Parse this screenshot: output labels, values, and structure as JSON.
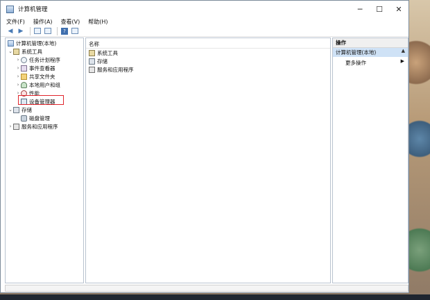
{
  "window": {
    "title": "计算机管理",
    "controls": {
      "minimize": "─",
      "maximize": "☐",
      "close": "✕"
    }
  },
  "menu": [
    "文件(F)",
    "操作(A)",
    "查看(V)",
    "帮助(H)"
  ],
  "toolbar": {
    "help": "?"
  },
  "tree": {
    "root": "计算机管理(本地)",
    "items": [
      {
        "label": "系统工具",
        "expander": "⌄",
        "icon": "tools-icon"
      },
      {
        "label": "任务计划程序",
        "expander": "›",
        "icon": "clock-icon"
      },
      {
        "label": "事件查看器",
        "expander": "›",
        "icon": "log-icon"
      },
      {
        "label": "共享文件夹",
        "expander": "›",
        "icon": "folder-icon"
      },
      {
        "label": "本地用户和组",
        "expander": "›",
        "icon": "users-icon"
      },
      {
        "label": "性能",
        "expander": "›",
        "icon": "performance-icon"
      },
      {
        "label": "设备管理器",
        "expander": "",
        "icon": "device-manager-icon"
      },
      {
        "label": "存储",
        "expander": "⌄",
        "icon": "storage-icon"
      },
      {
        "label": "磁盘管理",
        "expander": "",
        "icon": "disk-icon"
      },
      {
        "label": "服务和应用程序",
        "expander": "›",
        "icon": "services-icon"
      }
    ]
  },
  "content": {
    "column_header": "名称",
    "items": [
      "系统工具",
      "存储",
      "服务和应用程序"
    ]
  },
  "actions": {
    "header": "操作",
    "section": "计算机管理(本地)",
    "section_arrow": "▲",
    "item": "更多操作",
    "item_arrow": "▶"
  },
  "colors": {
    "highlight": "#e0242b",
    "selection": "#cfe2f6"
  }
}
